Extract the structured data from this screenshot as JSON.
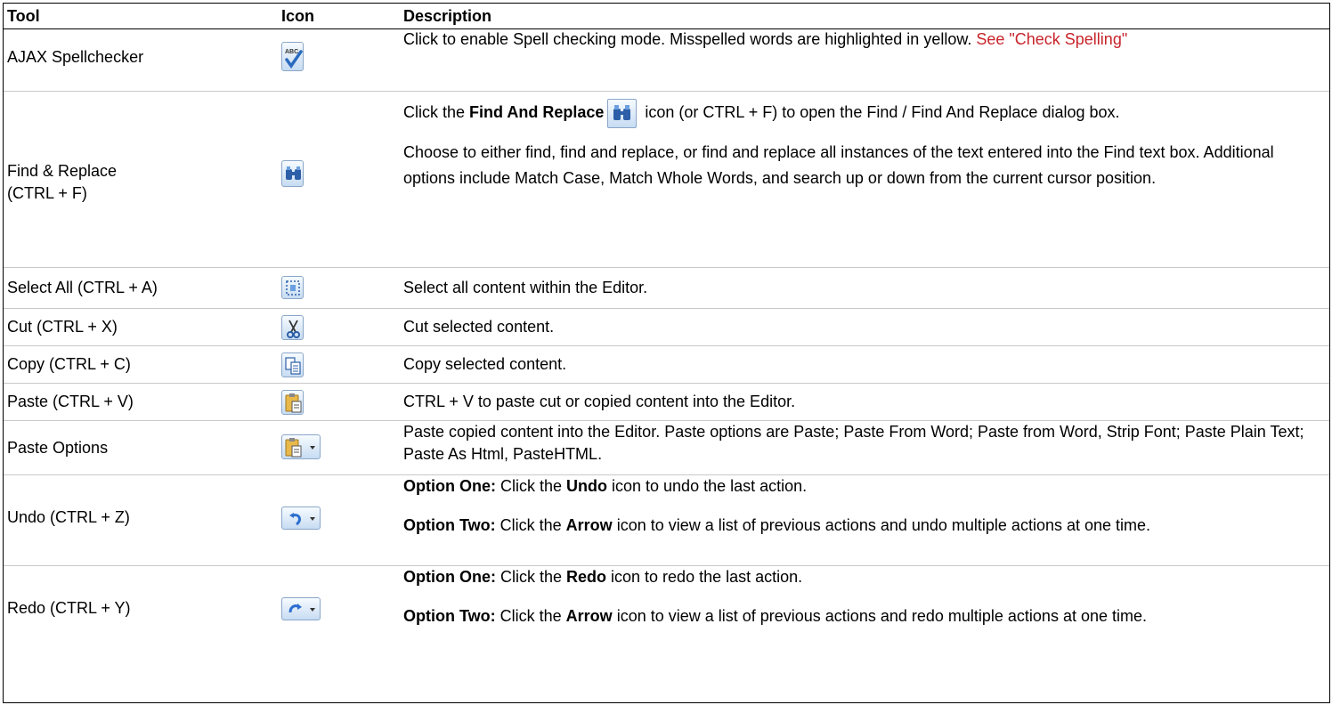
{
  "headers": {
    "tool": "Tool",
    "icon": "Icon",
    "description": "Description"
  },
  "rows": [
    {
      "tool": "AJAX Spellchecker",
      "icon": "spellcheck-icon",
      "desc_text": "Click to enable Spell checking mode. Misspelled words are highlighted in yellow. ",
      "desc_link": "See \"Check Spelling\""
    },
    {
      "tool_line1": "Find & Replace",
      "tool_line2": "(CTRL + F)",
      "icon": "binoculars-icon",
      "p1_a": "Click the ",
      "p1_b": "Find And Replace",
      "p1_c": " icon (or CTRL + F) to open the Find / Find And Replace dialog box.",
      "p2": "Choose to either find, find and replace, or find and replace all instances of the text entered into the Find text box. Additional options include Match Case, Match Whole Words, and search up or down from the current cursor position."
    },
    {
      "tool": "Select All (CTRL + A)",
      "icon": "select-all-icon",
      "desc": "Select all content within the Editor."
    },
    {
      "tool": "Cut (CTRL + X)",
      "icon": "scissors-icon",
      "desc": "Cut selected content."
    },
    {
      "tool": "Copy (CTRL + C)",
      "icon": "copy-icon",
      "desc": "Copy selected content."
    },
    {
      "tool": "Paste (CTRL + V)",
      "icon": "paste-icon",
      "desc": "CTRL + V to paste cut or copied content into the Editor."
    },
    {
      "tool": "Paste Options",
      "icon": "paste-options-icon",
      "desc": "Paste copied content into the Editor. Paste options are Paste; Paste From Word; Paste from Word, Strip Font; Paste Plain Text; Paste As Html, PasteHTML."
    },
    {
      "tool": "Undo (CTRL + Z)",
      "icon": "undo-icon",
      "o1_label": "Option One:",
      "o1_a": " Click the ",
      "o1_b": "Undo",
      "o1_c": " icon to undo the last action.",
      "o2_label": "Option Two:",
      "o2_a": " Click the ",
      "o2_b": "Arrow",
      "o2_c": " icon to view a list of previous actions and undo multiple actions at one time."
    },
    {
      "tool": "Redo (CTRL + Y)",
      "icon": "redo-icon",
      "o1_label": "Option One:",
      "o1_a": " Click the ",
      "o1_b": "Redo",
      "o1_c": " icon to redo the last action.",
      "o2_label": "Option Two:",
      "o2_a": " Click the ",
      "o2_b": "Arrow",
      "o2_c": " icon to view a list of previous actions and redo multiple actions at one time."
    }
  ]
}
